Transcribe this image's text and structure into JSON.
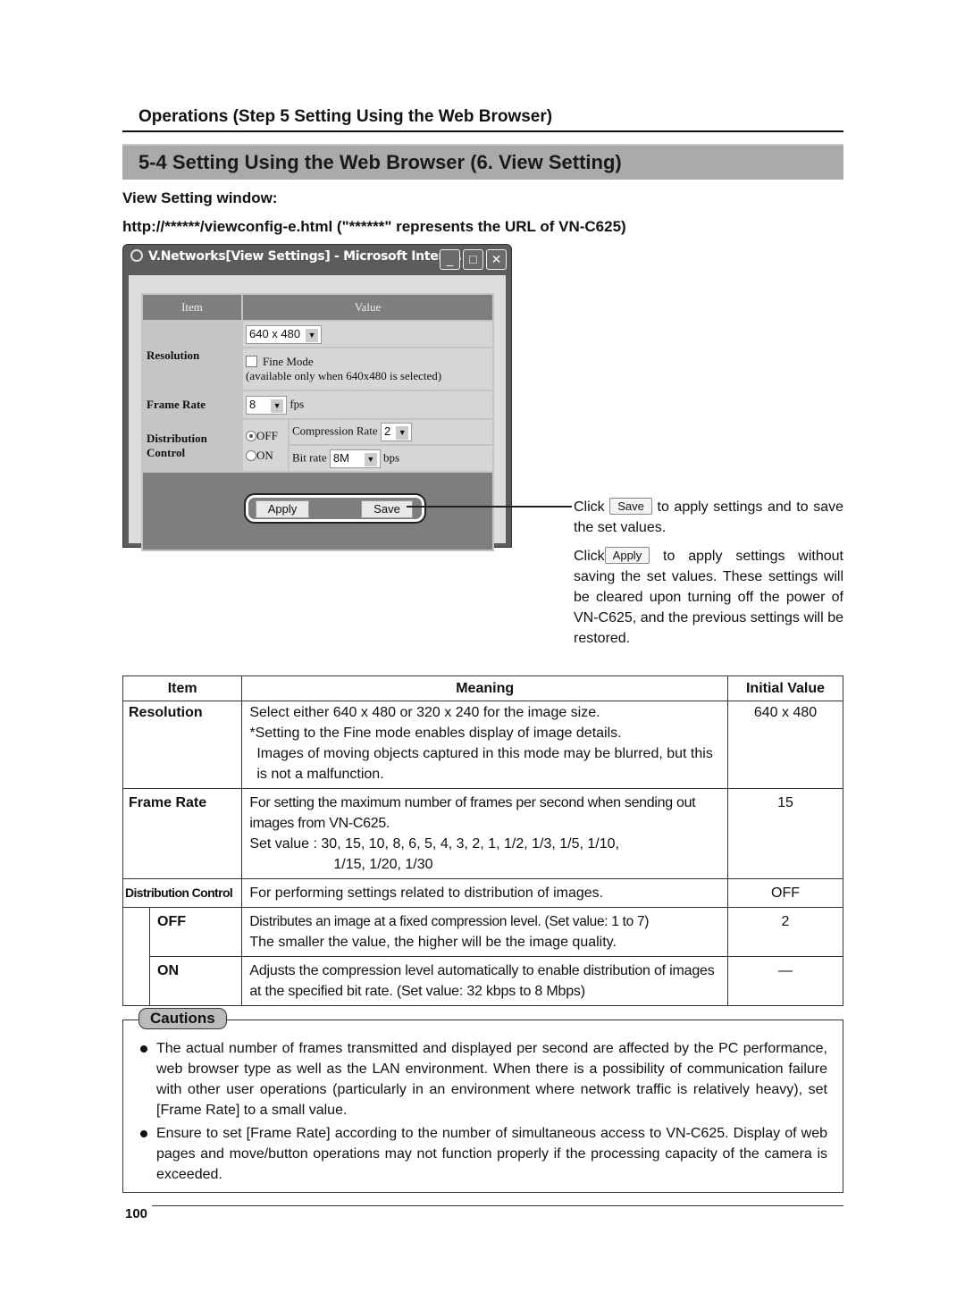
{
  "header": {
    "operations_title": "Operations (Step 5 Setting Using the Web Browser)",
    "section_title": "5-4 Setting Using the Web Browser (6. View Setting)",
    "window_label": "View Setting window:",
    "url_line": "http://******/viewconfig-e.html (\"******\" represents the URL of VN-C625)"
  },
  "browser": {
    "title": "V.Networks[View Settings] - Microsoft Intern...",
    "controls": {
      "minimize": "_",
      "maximize": "□",
      "close": "✕"
    },
    "table": {
      "col_item": "Item",
      "col_value": "Value",
      "resolution_label": "Resolution",
      "resolution_value": "640 x 480",
      "fine_mode_label": "Fine Mode",
      "fine_mode_checked": false,
      "fine_mode_note": "(available only when 640x480 is selected)",
      "frame_rate_label": "Frame Rate",
      "frame_rate_value": "8",
      "frame_rate_unit": "fps",
      "dist_label_1": "Distribution",
      "dist_label_2": "Control",
      "off_label": "OFF",
      "on_label": "ON",
      "selected_mode": "OFF",
      "compression_label": "Compression Rate",
      "compression_value": "2",
      "bitrate_label": "Bit rate",
      "bitrate_value": "8M",
      "bitrate_unit": "bps"
    },
    "apply_label": "Apply",
    "save_label": "Save"
  },
  "notes": {
    "save_pre": "Click",
    "save_btn": "Save",
    "save_post": "to apply settings and to save the set values.",
    "apply_pre": "Click",
    "apply_btn": "Apply",
    "apply_post": "to apply settings without saving the set values. These settings will be cleared upon turning off the power of VN-C625, and the previous settings will be restored."
  },
  "table": {
    "headers": {
      "item": "Item",
      "meaning": "Meaning",
      "initial": "Initial Value"
    },
    "resolution": {
      "item": "Resolution",
      "line1": "Select either 640 x 480 or 320 x 240 for the image size.",
      "line2": "*Setting to the Fine mode enables display of image details.",
      "line3": "Images of moving objects captured in this mode may be blurred, but this is not a malfunction.",
      "initial": "640 x 480"
    },
    "frame_rate": {
      "item": "Frame Rate",
      "line1": "For setting the maximum number of frames per second when sending out images from VN-C625.",
      "line2": "Set value : 30, 15, 10, 8, 6, 5, 4, 3, 2, 1, 1/2, 1/3, 1/5, 1/10,",
      "line3": "1/15, 1/20, 1/30",
      "initial": "15"
    },
    "distribution": {
      "item": "Distribution Control",
      "meaning": "For performing settings related to distribution of images.",
      "initial": "OFF"
    },
    "off": {
      "item": "OFF",
      "line1": "Distributes an image at a fixed compression level. (Set value: 1 to 7)",
      "line2": "The smaller the value, the higher will be the image quality.",
      "initial": "2"
    },
    "on": {
      "item": "ON",
      "meaning": "Adjusts the compression level automatically to enable distribution of images at the specified bit rate. (Set value: 32 kbps to 8 Mbps)",
      "initial": "—"
    }
  },
  "cautions": {
    "title": "Cautions",
    "items": [
      "The actual number of frames transmitted and displayed per second are affected by the PC performance, web browser type as well as the LAN environment. When there is a possibility of communication failure with other user operations (particularly in an environment where network traffic is relatively heavy), set [Frame Rate] to a small value.",
      "Ensure to set [Frame Rate] according to the number of simultaneous access to VN-C625. Display of web pages and move/button operations may not function properly if the processing capacity of the camera is exceeded."
    ]
  },
  "footer": {
    "page_number": "100"
  }
}
